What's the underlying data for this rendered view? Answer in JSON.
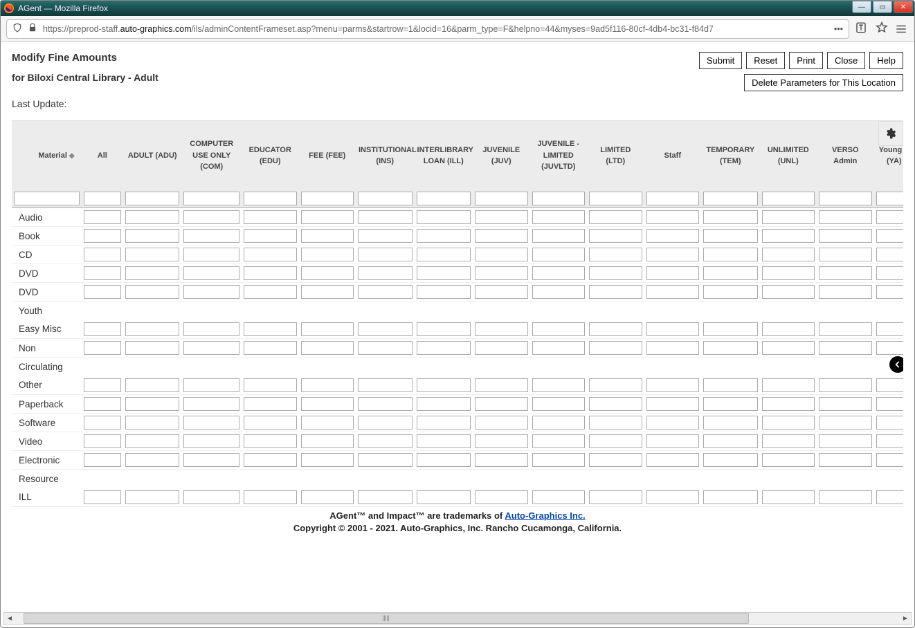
{
  "window": {
    "title": "AGent — Mozilla Firefox"
  },
  "url": {
    "proto": "https://",
    "sub": "preprod-staff.",
    "domain": "auto-graphics.com",
    "path": "/ils/adminContentFrameset.asp?menu=parms&startrow=1&locid=16&parm_type=F&helpno=44&myses=9ad5f116-80cf-4db4-bc31-f84d7"
  },
  "header": {
    "title": "Modify Fine Amounts",
    "subtitle": "for Biloxi Central Library - Adult",
    "last_update_label": "Last Update:",
    "buttons": {
      "submit": "Submit",
      "reset": "Reset",
      "print": "Print",
      "close": "Close",
      "help": "Help"
    },
    "delete_label": "Delete Parameters for This Location"
  },
  "columns": [
    "Material",
    "All",
    "ADULT (ADU)",
    "COMPUTER USE ONLY (COM)",
    "EDUCATOR (EDU)",
    "FEE (FEE)",
    "INSTITUTIONAL (INS)",
    "INTERLIBRARY LOAN (ILL)",
    "JUVENILE (JUV)",
    "JUVENILE - LIMITED (JUVLTD)",
    "LIMITED (LTD)",
    "Staff",
    "TEMPORARY (TEM)",
    "UNLIMITED (UNL)",
    "VERSO Admin",
    "Young A (YA)"
  ],
  "rows": [
    "Audio",
    "Book",
    "CD",
    "DVD",
    "DVD Youth",
    "Easy Misc",
    "Non Circulating",
    "Other",
    "Paperback",
    "Software",
    "Video",
    "Electronic Resource",
    "ILL"
  ],
  "footer": {
    "line1a": "AGent™ and Impact™ are trademarks of ",
    "link": "Auto-Graphics Inc.",
    "line2": "Copyright © 2001 - 2021. Auto-Graphics, Inc. Rancho Cucamonga, California."
  }
}
